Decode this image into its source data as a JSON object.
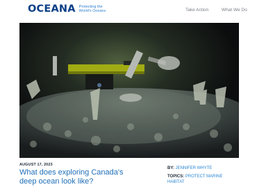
{
  "header": {
    "logo_text": "OCEANA",
    "tagline_line1": "Protecting the",
    "tagline_line2": "World's Oceans",
    "nav": [
      "Take Action",
      "What We Do"
    ]
  },
  "article": {
    "date": "AUGUST 17, 2023",
    "title_line1": "What does exploring Canada's",
    "title_line2": "deep ocean look like?",
    "by_label": "BY:",
    "author": "JENNIFER WHYTE",
    "topics_label": "TOPICS:",
    "topic": "PROTECT MARINE HABITAT"
  },
  "colors": {
    "brand_navy": "#0b3f86",
    "brand_blue": "#2f7fcd",
    "link_blue": "#2a86d3"
  }
}
